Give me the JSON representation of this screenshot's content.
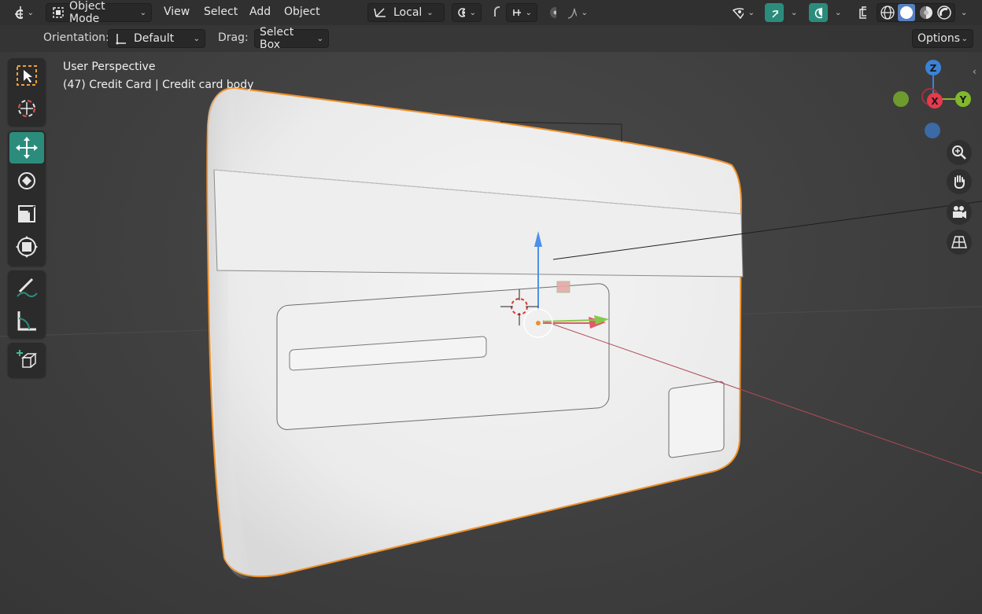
{
  "header": {
    "editor_type_icon": "editor-type-icon",
    "mode_label": "Object Mode",
    "menus": [
      "View",
      "Select",
      "Add",
      "Object"
    ],
    "transform_orientation": "Local",
    "pivot_icon": "pivot-point-icon",
    "snap_icon": "snap-icon",
    "proportional_icon": "proportional-editing-icon",
    "falloff_icon": "falloff-curve-icon",
    "visibility_icon": "visibility-icon",
    "gizmo_icon": "gizmo-icon",
    "overlay_icon": "overlay-icon",
    "xray_icon": "xray-icon",
    "shading_modes": [
      "wireframe",
      "solid",
      "material-preview",
      "rendered"
    ],
    "active_shading": "solid"
  },
  "tool_settings": {
    "orientation_label": "Orientation:",
    "orientation_value": "Default",
    "drag_label": "Drag:",
    "drag_value": "Select Box",
    "options_label": "Options"
  },
  "viewport": {
    "perspective_label": "User Perspective",
    "object_info": "(47) Credit Card | Credit card body"
  },
  "toolbar": {
    "tools": [
      "select-box",
      "cursor",
      "move",
      "rotate",
      "scale",
      "transform",
      "annotate",
      "measure",
      "add-cube"
    ],
    "active_tool": "move"
  },
  "navigation_gizmo": {
    "axes": {
      "z": "Z",
      "y": "Y",
      "x": "X"
    },
    "colors": {
      "x": "#e8394d",
      "y": "#82b82c",
      "z": "#3b82d6"
    }
  },
  "nav_buttons": [
    "zoom-icon",
    "pan-hand-icon",
    "camera-view-icon",
    "perspective-grid-icon"
  ],
  "colors": {
    "accent": "#2c8c7c",
    "selection_outline": "#f0902a",
    "header_bg": "#303030",
    "viewport_bg": "#3d3d3d"
  }
}
